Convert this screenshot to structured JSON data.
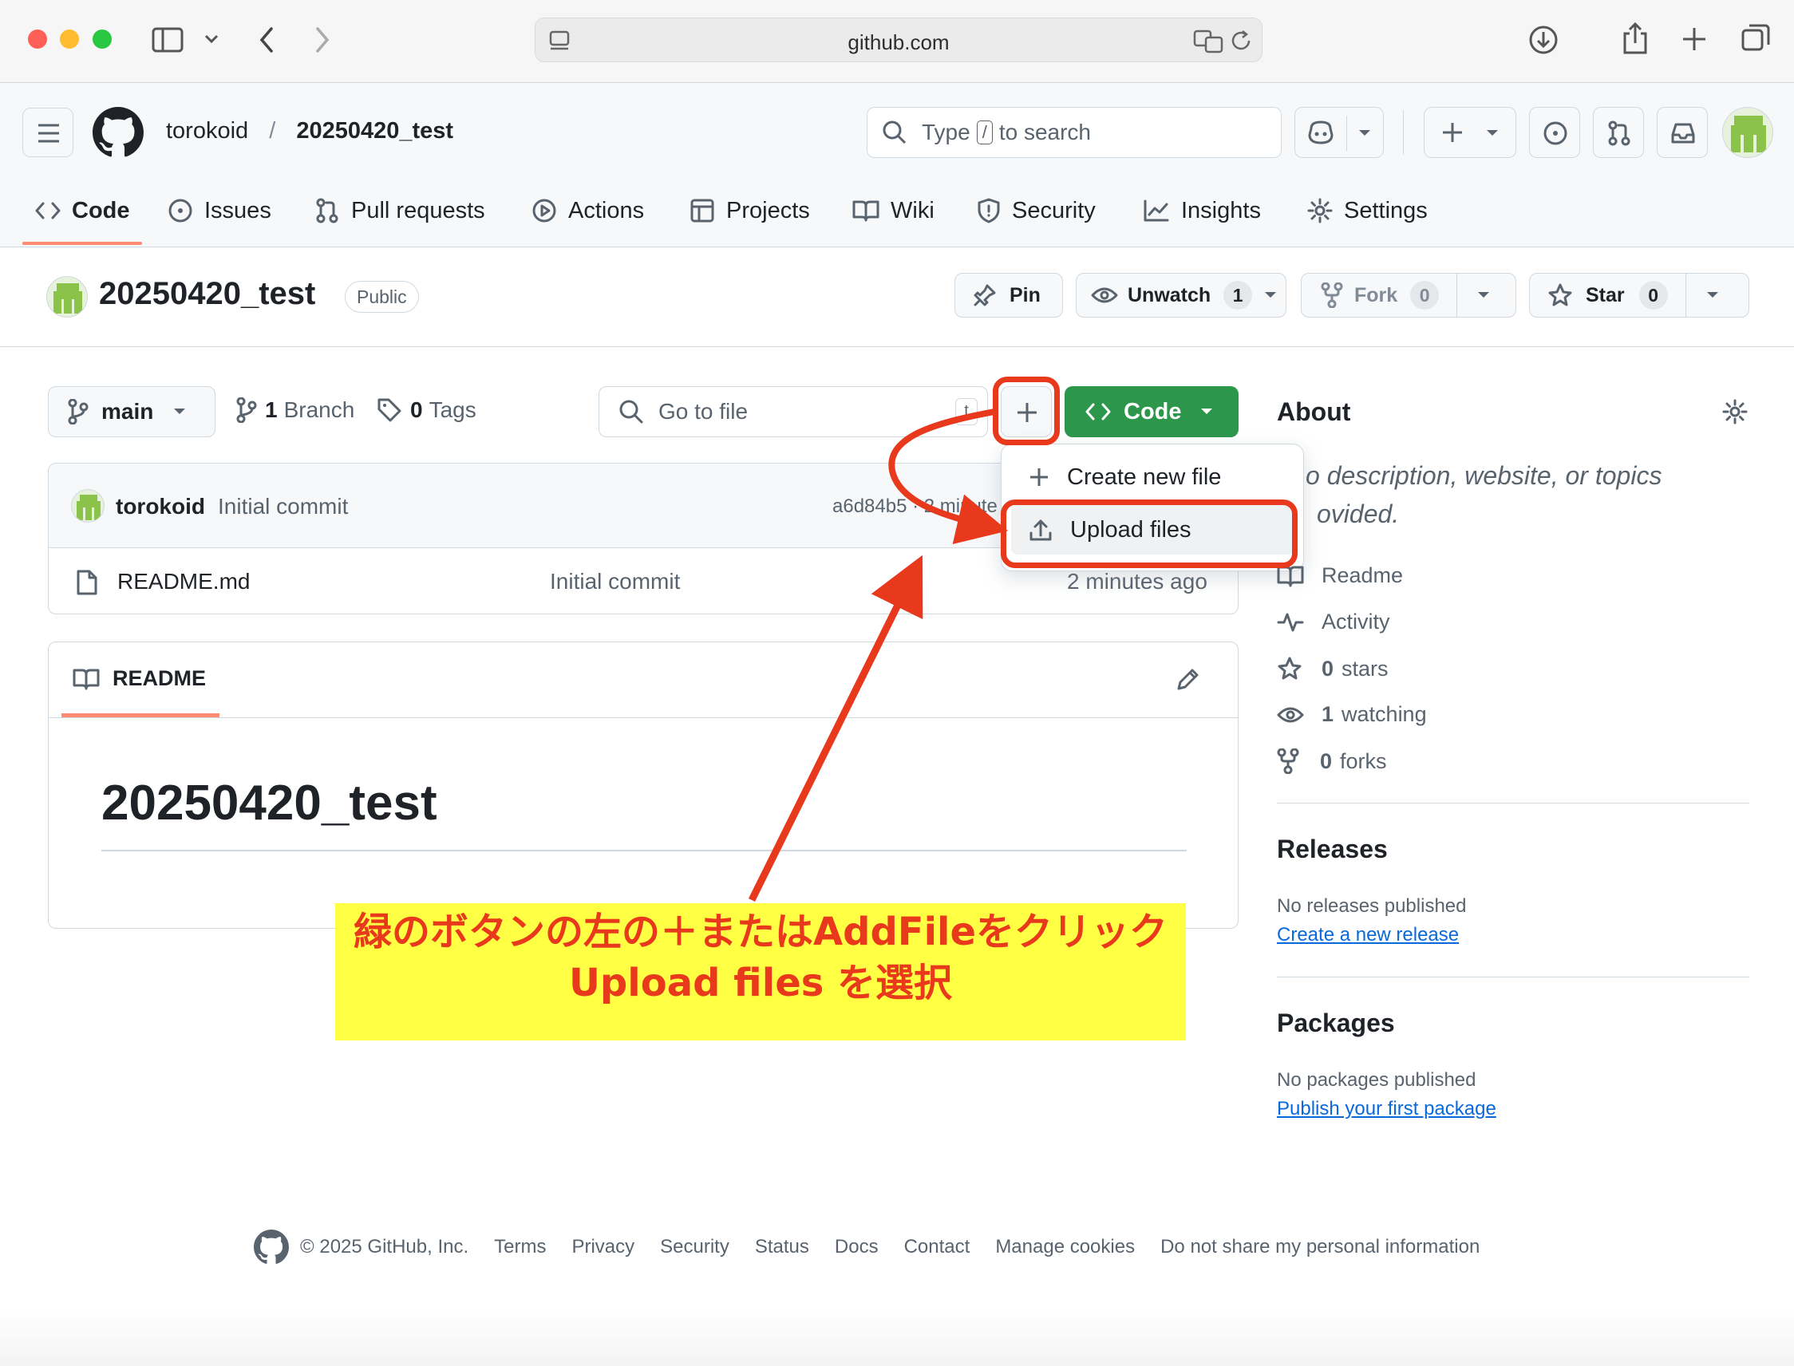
{
  "browser": {
    "url": "github.com"
  },
  "header": {
    "owner": "torokoid",
    "separator": "/",
    "repo": "20250420_test",
    "search_prefix": "Type",
    "search_key": "/",
    "search_suffix": "to search"
  },
  "nav": {
    "tabs": [
      {
        "label": "Code",
        "icon": "code-icon"
      },
      {
        "label": "Issues",
        "icon": "issue-icon"
      },
      {
        "label": "Pull requests",
        "icon": "pull-request-icon"
      },
      {
        "label": "Actions",
        "icon": "play-icon"
      },
      {
        "label": "Projects",
        "icon": "table-icon"
      },
      {
        "label": "Wiki",
        "icon": "book-icon"
      },
      {
        "label": "Security",
        "icon": "shield-icon"
      },
      {
        "label": "Insights",
        "icon": "graph-icon"
      },
      {
        "label": "Settings",
        "icon": "gear-icon"
      }
    ]
  },
  "repo": {
    "name": "20250420_test",
    "visibility": "Public",
    "pin": "Pin",
    "unwatch": "Unwatch",
    "watch_count": "1",
    "fork": "Fork",
    "fork_count": "0",
    "star": "Star",
    "star_count": "0"
  },
  "toolbar": {
    "branch": "main",
    "branches_count": "1",
    "branches_label": "Branch",
    "tags_count": "0",
    "tags_label": "Tags",
    "go_to_file": "Go to file",
    "go_to_file_key": "t",
    "code_button": "Code"
  },
  "menu": {
    "create": "Create new file",
    "upload": "Upload files"
  },
  "commit": {
    "author": "torokoid",
    "message": "Initial commit",
    "hash": "a6d84b5 · 2 minute"
  },
  "files": [
    {
      "name": "README.md",
      "message": "Initial commit",
      "time": "2 minutes ago"
    }
  ],
  "readme": {
    "tab": "README",
    "heading": "20250420_test"
  },
  "about": {
    "title": "About",
    "description_line1": "o description, website, or topics",
    "description_line2": "ovided.",
    "readme": "Readme",
    "activity": "Activity",
    "stars_count": "0",
    "stars": "stars",
    "watching_count": "1",
    "watching": "watching",
    "forks_count": "0",
    "forks": "forks"
  },
  "releases": {
    "title": "Releases",
    "empty": "No releases published",
    "link": "Create a new release"
  },
  "packages": {
    "title": "Packages",
    "empty": "No packages published",
    "link": "Publish your first package"
  },
  "footer": {
    "copyright": "© 2025 GitHub, Inc.",
    "links": [
      "Terms",
      "Privacy",
      "Security",
      "Status",
      "Docs",
      "Contact",
      "Manage cookies",
      "Do not share my personal information"
    ]
  },
  "annotation": {
    "line1": "緑のボタンの左の＋またはAddFileをクリック",
    "line2": "Upload files を選択",
    "color": "#e8391d",
    "background": "#ffff44"
  },
  "colors": {
    "green_button": "#2c974b",
    "tab_underline": "#fd8c73",
    "link": "#0969da"
  }
}
